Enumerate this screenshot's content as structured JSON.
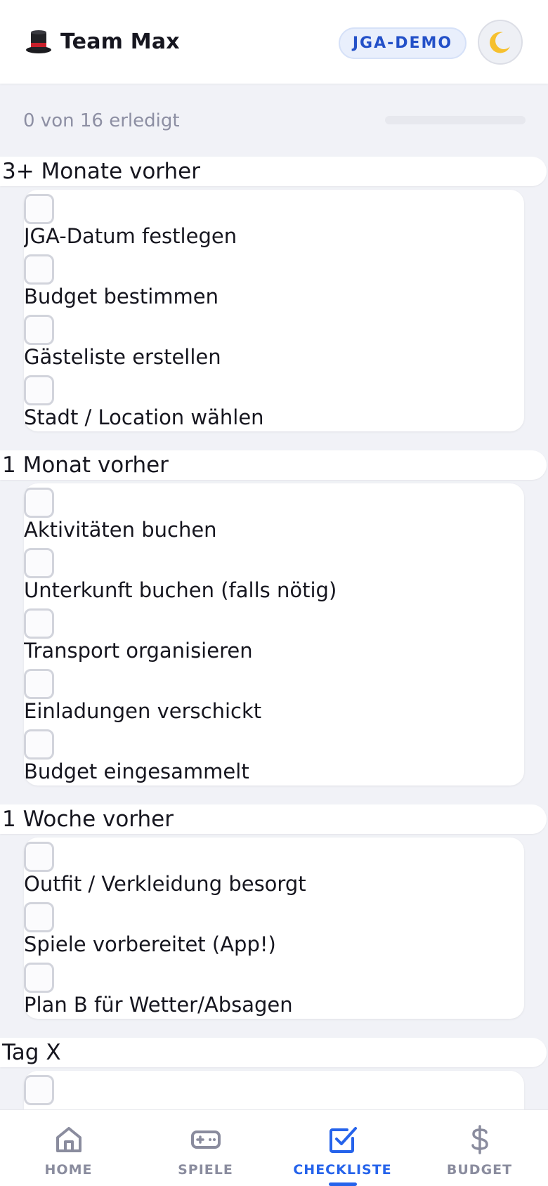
{
  "header": {
    "title": "Team Max",
    "title_icon": "top-hat-icon",
    "badge": "JGA-DEMO",
    "theme_icon": "moon-icon"
  },
  "progress": {
    "text": "0 von 16 erledigt",
    "done": 0,
    "total": 16,
    "fraction": 0
  },
  "sections": [
    {
      "title": "3+ Monate vorher",
      "tasks": [
        {
          "label": "JGA-Datum festlegen",
          "checked": false
        },
        {
          "label": "Budget bestimmen",
          "checked": false
        },
        {
          "label": "Gästeliste erstellen",
          "checked": false
        },
        {
          "label": "Stadt / Location wählen",
          "checked": false
        }
      ]
    },
    {
      "title": "1 Monat vorher",
      "tasks": [
        {
          "label": "Aktivitäten buchen",
          "checked": false
        },
        {
          "label": "Unterkunft buchen (falls nötig)",
          "checked": false
        },
        {
          "label": "Transport organisieren",
          "checked": false
        },
        {
          "label": "Einladungen verschickt",
          "checked": false
        },
        {
          "label": "Budget eingesammelt",
          "checked": false
        }
      ]
    },
    {
      "title": "1 Woche vorher",
      "tasks": [
        {
          "label": "Outfit / Verkleidung besorgt",
          "checked": false
        },
        {
          "label": "Spiele vorbereitet (App!)",
          "checked": false
        },
        {
          "label": "Plan B für Wetter/Absagen",
          "checked": false
        }
      ]
    },
    {
      "title": "Tag X",
      "tasks": [
        {
          "label": "",
          "checked": false
        }
      ]
    }
  ],
  "nav": [
    {
      "label": "HOME",
      "icon": "home-icon",
      "active": false
    },
    {
      "label": "SPIELE",
      "icon": "gamepad-icon",
      "active": false
    },
    {
      "label": "CHECKLISTE",
      "icon": "checkbox-icon",
      "active": true
    },
    {
      "label": "BUDGET",
      "icon": "dollar-icon",
      "active": false
    }
  ],
  "colors": {
    "accent": "#2563eb",
    "badge_bg": "#e9effc",
    "badge_text": "#2350c8",
    "inactive_nav": "#8a8c9e",
    "page_bg": "#f1f2f7"
  }
}
